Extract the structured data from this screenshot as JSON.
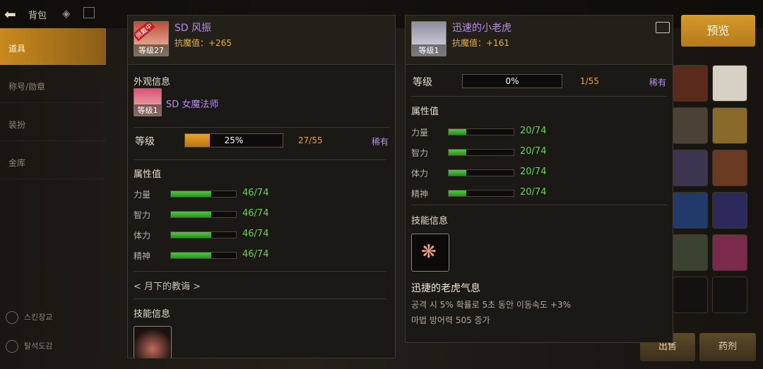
{
  "sidebar": {
    "title": "背包",
    "items": [
      "道具",
      "称号/勋章",
      "装扮",
      "金库"
    ],
    "bottom": [
      "스킨장교",
      "탈석도감"
    ]
  },
  "preview_button": "预览",
  "bottom_buttons": [
    "出售",
    "药剂"
  ],
  "left_panel": {
    "pet_name": "SD 风振",
    "pet_badge": "佩戴中",
    "pet_level": "等级27",
    "magic_resist": "抗魔值：+265",
    "appearance_title": "外观信息",
    "appearance_name": "SD 女魔法师",
    "appearance_level": "等级1",
    "level_label": "等级",
    "level_percent": "25%",
    "level_fraction": 0.25,
    "level_count": "27/55",
    "rarity": "稀有",
    "attr_title": "属性值",
    "stats": [
      {
        "label": "力量",
        "value": "46/74",
        "fraction": 0.62
      },
      {
        "label": "智力",
        "value": "46/74",
        "fraction": 0.62
      },
      {
        "label": "体力",
        "value": "46/74",
        "fraction": 0.62
      },
      {
        "label": "精神",
        "value": "46/74",
        "fraction": 0.62
      }
    ],
    "link_text": "< 月下的教诲 >",
    "skill_title": "技能信息"
  },
  "right_panel": {
    "pet_name": "迅速的小老虎",
    "pet_level": "等级1",
    "magic_resist": "抗魔值：+161",
    "level_label": "等级",
    "level_percent": "0%",
    "level_fraction": 0.0,
    "level_count": "1/55",
    "rarity": "稀有",
    "attr_title": "属性值",
    "stats": [
      {
        "label": "力量",
        "value": "20/74",
        "fraction": 0.27
      },
      {
        "label": "智力",
        "value": "20/74",
        "fraction": 0.27
      },
      {
        "label": "体力",
        "value": "20/74",
        "fraction": 0.27
      },
      {
        "label": "精神",
        "value": "20/74",
        "fraction": 0.27
      }
    ],
    "skill_title": "技能信息",
    "skill_name": "迅捷的老虎气息",
    "skill_desc_1": "공격 시 5% 확률로 5초 동안 이동속도 +3%",
    "skill_desc_2": "마법 방어력 505 증가"
  }
}
